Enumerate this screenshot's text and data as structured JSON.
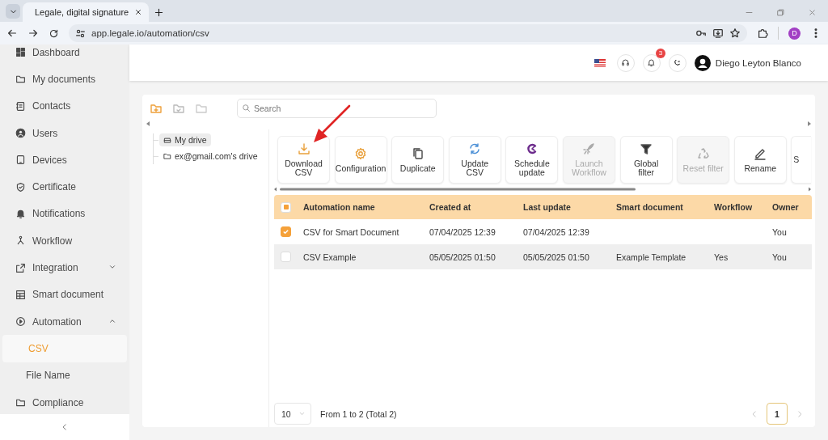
{
  "browser": {
    "tab_title": "Legale, digital signature",
    "url": "app.legale.io/automation/csv",
    "profile_initial": "D"
  },
  "sidebar": {
    "items": [
      {
        "label": "Dashboard",
        "selected": false
      },
      {
        "label": "My documents",
        "selected": false
      },
      {
        "label": "Contacts",
        "selected": false
      },
      {
        "label": "Users",
        "selected": false
      },
      {
        "label": "Devices",
        "selected": false
      },
      {
        "label": "Certificate",
        "selected": false
      },
      {
        "label": "Notifications",
        "selected": false
      },
      {
        "label": "Workflow",
        "selected": false
      },
      {
        "label": "Integration",
        "selected": false,
        "expanded": false
      },
      {
        "label": "Smart document",
        "selected": false
      },
      {
        "label": "Automation",
        "selected": false,
        "expanded": true,
        "children": [
          {
            "label": "CSV",
            "selected": true
          },
          {
            "label": "File Name",
            "selected": false
          }
        ]
      },
      {
        "label": "Compliance",
        "selected": false
      }
    ]
  },
  "header": {
    "notification_count": "3",
    "user_name": "Diego Leyton Blanco"
  },
  "workspace": {
    "search": {
      "placeholder": "Search"
    },
    "drives": [
      {
        "label": "My drive",
        "selected": true
      },
      {
        "label": "ex@gmail.com's drive",
        "selected": false
      }
    ],
    "toolbar": [
      {
        "label": "Download\nCSV",
        "disabled": false
      },
      {
        "label": "Configuration",
        "disabled": false
      },
      {
        "label": "Duplicate",
        "disabled": false
      },
      {
        "label": "Update\nCSV",
        "disabled": false
      },
      {
        "label": "Schedule\nupdate",
        "disabled": false
      },
      {
        "label": "Launch\nWorkflow",
        "disabled": true
      },
      {
        "label": "Global\nfilter",
        "disabled": false
      },
      {
        "label": "Reset filter",
        "disabled": true
      },
      {
        "label": "Rename",
        "disabled": false
      },
      {
        "label": "S",
        "disabled": false
      }
    ],
    "table": {
      "select_all": {
        "indeterminate": true
      },
      "columns": [
        "Automation name",
        "Created at",
        "Last update",
        "Smart document",
        "Workflow",
        "Owner"
      ],
      "rows": [
        {
          "checked": true,
          "cells": [
            "CSV for Smart Document",
            "07/04/2025 12:39",
            "07/04/2025 12:39",
            "",
            "",
            "You"
          ]
        },
        {
          "checked": false,
          "cells": [
            "CSV Example",
            "05/05/2025 01:50",
            "05/05/2025 01:50",
            "Example Template",
            "Yes",
            "You"
          ]
        }
      ]
    },
    "pager": {
      "page_size": "10",
      "summary": "From 1 to 2 (Total 2)",
      "pages": [
        {
          "label": "1",
          "selected": true
        }
      ]
    }
  }
}
